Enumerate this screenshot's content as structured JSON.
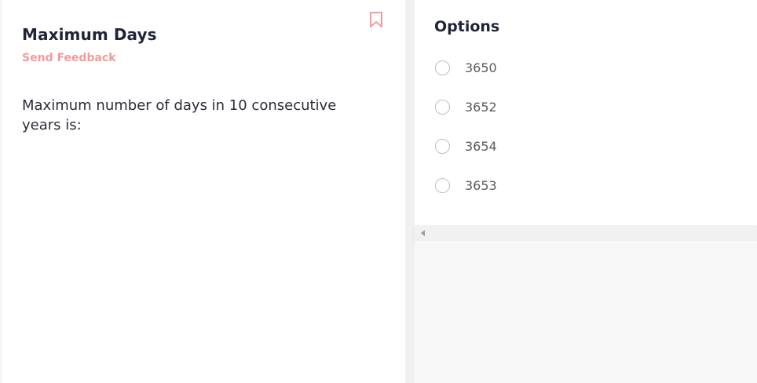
{
  "question": {
    "title": "Maximum Days",
    "feedback_label": "Send Feedback",
    "body": "Maximum number of days in 10 consecutive years is:",
    "bookmark_icon": "bookmark-icon"
  },
  "options": {
    "heading": "Options",
    "items": [
      {
        "label": "3650"
      },
      {
        "label": "3652"
      },
      {
        "label": "3654"
      },
      {
        "label": "3653"
      }
    ]
  },
  "colors": {
    "accent": "#f39a9a",
    "title": "#1f2438",
    "text": "#2a2d3a",
    "option_text": "#5a5a5a",
    "radio_border": "#bdbdbd"
  }
}
